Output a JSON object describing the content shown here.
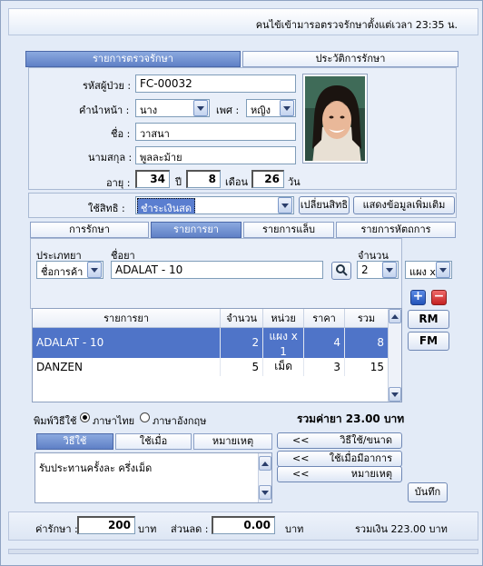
{
  "header": {
    "login_text": "คนไข้เข้ามารอตรวจรักษาตั้งแต่เวลา 23:35 น."
  },
  "top_tabs": [
    "รายการตรวจรักษา",
    "ประวัติการรักษา"
  ],
  "patient": {
    "id_label": "รหัสผู้ป่วย :",
    "id_value": "FC-00032",
    "prefix_label": "คำนำหน้า :",
    "prefix_value": "นาง",
    "sex_label": "เพศ :",
    "sex_value": "หญิง",
    "name_label": "ชื่อ :",
    "name_value": "วาสนา",
    "surname_label": "นามสกุล :",
    "surname_value": "พูลละม้าย",
    "age_label": "อายุ :",
    "age_years": "34",
    "years_unit": "ปี",
    "age_months": "8",
    "months_unit": "เดือน",
    "age_days": "26",
    "days_unit": "วัน",
    "right_label": "ใช้สิทธิ :",
    "right_value": "ชำระเงินสด",
    "change_right_button": "เปลี่ยนสิทธิ",
    "more_info_button": "แสดงข้อมูลเพิ่มเติม"
  },
  "sub_tabs": [
    "การรักษา",
    "รายการยา",
    "รายการแล็บ",
    "รายการหัตถการ"
  ],
  "drug_form": {
    "type_label": "ประเภทยา",
    "type_value": "ชื่อการค้า",
    "drug_label": "ชื่อยา",
    "drug_value": "ADALAT - 10",
    "qty_label": "จำนวน",
    "qty_value": "2",
    "unit_value": "แผง x"
  },
  "side_buttons": {
    "add": "+",
    "remove": "−",
    "rm": "RM",
    "fm": "FM"
  },
  "drug_table": {
    "headers": [
      "รายการยา",
      "จำนวน",
      "หน่วย",
      "ราคา",
      "รวม"
    ],
    "rows": [
      {
        "name": "ADALAT - 10",
        "qty": "2",
        "unit": "แผง x 1",
        "price": "4",
        "total": "8"
      },
      {
        "name": "DANZEN",
        "qty": "5",
        "unit": "เม็ด",
        "price": "3",
        "total": "15"
      }
    ]
  },
  "print_lang": {
    "label": "พิมพ์วิธีใช้",
    "thai": "ภาษาไทย",
    "english": "ภาษาอังกฤษ"
  },
  "drug_total": "รวมค่ายา 23.00 บาท",
  "usage_tabs": [
    "วิธีใช้",
    "ใช้เมื่อ",
    "หมายเหตุ"
  ],
  "usage_text": "รับประทานครั้งละ ครึ่งเม็ด",
  "usage_buttons": [
    {
      "arrow": "<<",
      "label": "วิธีใช้/ขนาด"
    },
    {
      "arrow": "<<",
      "label": "ใช้เมื่อมีอาการ"
    },
    {
      "arrow": "<<",
      "label": "หมายเหตุ"
    }
  ],
  "save_button": "บันทึก",
  "footer": {
    "fee_label": "ค่ารักษา :",
    "fee_value": "200",
    "baht1": "บาท",
    "discount_label": "ส่วนลด :",
    "discount_value": "0.00",
    "baht2": "บาท",
    "grand_total": "รวมเงิน 223.00 บาท"
  },
  "colors": {
    "active_tab": "#5f80c6",
    "selected_row": "#4f74c8",
    "background": "#e3ebf7"
  }
}
